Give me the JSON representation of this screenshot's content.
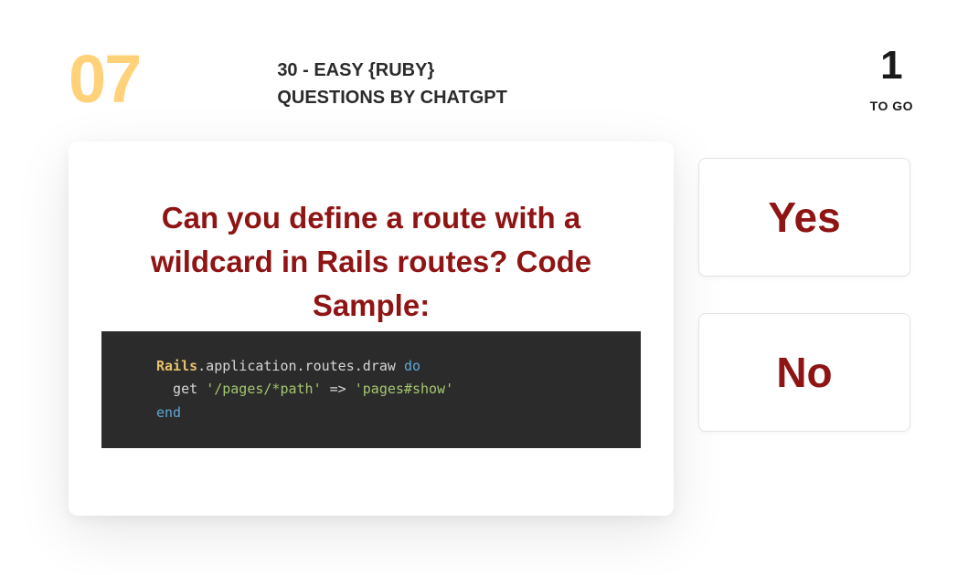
{
  "header": {
    "question_number": "07",
    "title_line1": "30 - EASY {RUBY}",
    "title_line2": "QUESTIONS BY CHATGPT",
    "remaining_count": "1",
    "remaining_label": "TO GO"
  },
  "question": {
    "text": "Can you define a route with a wildcard in Rails routes? Code Sample:"
  },
  "code": {
    "line1": {
      "const": "Rails",
      "rest": ".application.routes.draw ",
      "kw": "do"
    },
    "line2": {
      "indent": "  get ",
      "str1": "'/pages/*path'",
      "arrow": " => ",
      "str2": "'pages#show'"
    },
    "line3": {
      "kw": "end"
    }
  },
  "answers": {
    "yes": "Yes",
    "no": "No"
  }
}
